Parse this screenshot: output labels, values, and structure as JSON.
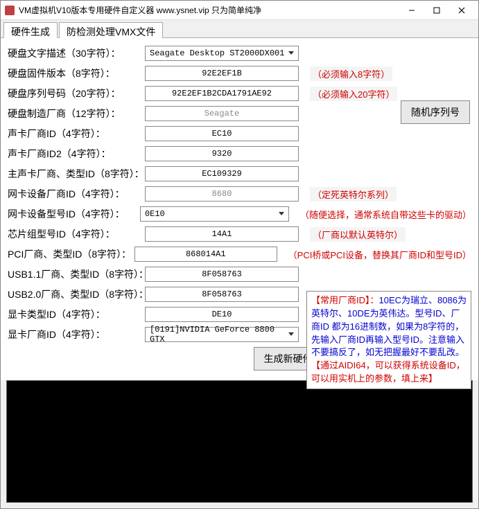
{
  "window": {
    "title": "VM虚拟机V10版本专用硬件自定义器    www.ysnet.vip    只为简单纯净"
  },
  "tabs": {
    "t1": "硬件生成",
    "t2": "防检测处理VMX文件"
  },
  "labels": {
    "disk_desc": "硬盘文字描述（30字符）：",
    "disk_fw": "硬盘固件版本（8字符）：",
    "disk_sn": "硬盘序列号码（20字符）：",
    "disk_mfr": "硬盘制造厂商（12字符）：",
    "snd_vid": "声卡厂商ID（4字符）：",
    "snd_vid2": "声卡厂商ID2（4字符）：",
    "mbd_snd": "主声卡厂商、类型ID（8字符）：",
    "nic_vid": "网卡设备厂商ID（4字符）：",
    "nic_did": "网卡设备型号ID（4字符）：",
    "chip_id": "芯片组型号ID（4字符）：",
    "pci": "PCI厂商、类型ID（8字符）：",
    "usb11": "USB1.1厂商、类型ID（8字符）：",
    "usb20": "USB2.0厂商、类型ID（8字符）：",
    "gpu_type": "显卡类型ID（4字符）：",
    "gpu_vid": "显卡厂商ID（4字符）："
  },
  "values": {
    "disk_desc": "Seagate Desktop ST2000DX001",
    "disk_fw": "92E2EF1B",
    "disk_sn": "92E2EF1B2CDA1791AE92",
    "disk_mfr": "Seagate",
    "snd_vid": "EC10",
    "snd_vid2": "9320",
    "mbd_snd": "EC109329",
    "nic_vid": "8680",
    "nic_did": "0E10",
    "chip_id": "14A1",
    "pci": "868014A1",
    "usb11": "8F058763",
    "usb20": "8F058763",
    "gpu_type": "DE10",
    "gpu_vid": "[0191]NVIDIA GeForce 8800 GTX"
  },
  "hints": {
    "disk_fw": "（必须输入8字符）",
    "disk_sn": "（必须输入20字符）",
    "nic_vid": "（定死英特尔系列）",
    "nic_did": "（随便选择，通常系统自带这些卡的驱动）",
    "chip_id": "（厂商以默认英特尔）",
    "pci": "（PCI桥或PCI设备，替换其厂商ID和型号ID）"
  },
  "buttons": {
    "random_sn": "随机序列号",
    "generate": "生成新硬件"
  },
  "infobox": {
    "p1a": "【常用厂商ID】：",
    "p1b": "10EC为瑞立、8086为英特尔、10DE为英伟达。型号ID、厂商ID 都为16进制数，如果为8字符的，先输入厂商ID再输入型号ID。注意输入不要搞反了，如无把握最好不要乱改。",
    "p2a": "【通过AIDI64，可以获得系统设备ID，可以用实机上的参数，填上来】"
  }
}
